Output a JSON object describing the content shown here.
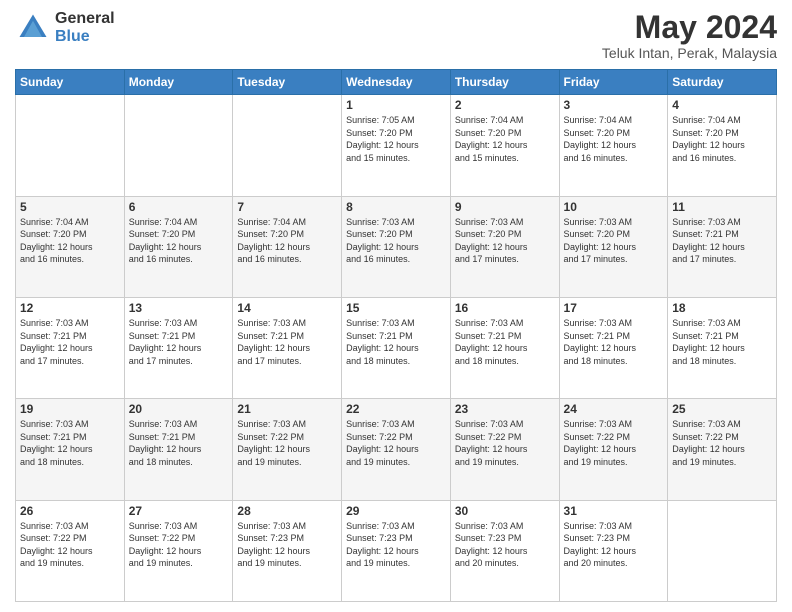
{
  "header": {
    "logo_general": "General",
    "logo_blue": "Blue",
    "month_year": "May 2024",
    "location": "Teluk Intan, Perak, Malaysia"
  },
  "days_of_week": [
    "Sunday",
    "Monday",
    "Tuesday",
    "Wednesday",
    "Thursday",
    "Friday",
    "Saturday"
  ],
  "weeks": [
    [
      {
        "day": "",
        "text": ""
      },
      {
        "day": "",
        "text": ""
      },
      {
        "day": "",
        "text": ""
      },
      {
        "day": "1",
        "text": "Sunrise: 7:05 AM\nSunset: 7:20 PM\nDaylight: 12 hours\nand 15 minutes."
      },
      {
        "day": "2",
        "text": "Sunrise: 7:04 AM\nSunset: 7:20 PM\nDaylight: 12 hours\nand 15 minutes."
      },
      {
        "day": "3",
        "text": "Sunrise: 7:04 AM\nSunset: 7:20 PM\nDaylight: 12 hours\nand 16 minutes."
      },
      {
        "day": "4",
        "text": "Sunrise: 7:04 AM\nSunset: 7:20 PM\nDaylight: 12 hours\nand 16 minutes."
      }
    ],
    [
      {
        "day": "5",
        "text": "Sunrise: 7:04 AM\nSunset: 7:20 PM\nDaylight: 12 hours\nand 16 minutes."
      },
      {
        "day": "6",
        "text": "Sunrise: 7:04 AM\nSunset: 7:20 PM\nDaylight: 12 hours\nand 16 minutes."
      },
      {
        "day": "7",
        "text": "Sunrise: 7:04 AM\nSunset: 7:20 PM\nDaylight: 12 hours\nand 16 minutes."
      },
      {
        "day": "8",
        "text": "Sunrise: 7:03 AM\nSunset: 7:20 PM\nDaylight: 12 hours\nand 16 minutes."
      },
      {
        "day": "9",
        "text": "Sunrise: 7:03 AM\nSunset: 7:20 PM\nDaylight: 12 hours\nand 17 minutes."
      },
      {
        "day": "10",
        "text": "Sunrise: 7:03 AM\nSunset: 7:20 PM\nDaylight: 12 hours\nand 17 minutes."
      },
      {
        "day": "11",
        "text": "Sunrise: 7:03 AM\nSunset: 7:21 PM\nDaylight: 12 hours\nand 17 minutes."
      }
    ],
    [
      {
        "day": "12",
        "text": "Sunrise: 7:03 AM\nSunset: 7:21 PM\nDaylight: 12 hours\nand 17 minutes."
      },
      {
        "day": "13",
        "text": "Sunrise: 7:03 AM\nSunset: 7:21 PM\nDaylight: 12 hours\nand 17 minutes."
      },
      {
        "day": "14",
        "text": "Sunrise: 7:03 AM\nSunset: 7:21 PM\nDaylight: 12 hours\nand 17 minutes."
      },
      {
        "day": "15",
        "text": "Sunrise: 7:03 AM\nSunset: 7:21 PM\nDaylight: 12 hours\nand 18 minutes."
      },
      {
        "day": "16",
        "text": "Sunrise: 7:03 AM\nSunset: 7:21 PM\nDaylight: 12 hours\nand 18 minutes."
      },
      {
        "day": "17",
        "text": "Sunrise: 7:03 AM\nSunset: 7:21 PM\nDaylight: 12 hours\nand 18 minutes."
      },
      {
        "day": "18",
        "text": "Sunrise: 7:03 AM\nSunset: 7:21 PM\nDaylight: 12 hours\nand 18 minutes."
      }
    ],
    [
      {
        "day": "19",
        "text": "Sunrise: 7:03 AM\nSunset: 7:21 PM\nDaylight: 12 hours\nand 18 minutes."
      },
      {
        "day": "20",
        "text": "Sunrise: 7:03 AM\nSunset: 7:21 PM\nDaylight: 12 hours\nand 18 minutes."
      },
      {
        "day": "21",
        "text": "Sunrise: 7:03 AM\nSunset: 7:22 PM\nDaylight: 12 hours\nand 19 minutes."
      },
      {
        "day": "22",
        "text": "Sunrise: 7:03 AM\nSunset: 7:22 PM\nDaylight: 12 hours\nand 19 minutes."
      },
      {
        "day": "23",
        "text": "Sunrise: 7:03 AM\nSunset: 7:22 PM\nDaylight: 12 hours\nand 19 minutes."
      },
      {
        "day": "24",
        "text": "Sunrise: 7:03 AM\nSunset: 7:22 PM\nDaylight: 12 hours\nand 19 minutes."
      },
      {
        "day": "25",
        "text": "Sunrise: 7:03 AM\nSunset: 7:22 PM\nDaylight: 12 hours\nand 19 minutes."
      }
    ],
    [
      {
        "day": "26",
        "text": "Sunrise: 7:03 AM\nSunset: 7:22 PM\nDaylight: 12 hours\nand 19 minutes."
      },
      {
        "day": "27",
        "text": "Sunrise: 7:03 AM\nSunset: 7:22 PM\nDaylight: 12 hours\nand 19 minutes."
      },
      {
        "day": "28",
        "text": "Sunrise: 7:03 AM\nSunset: 7:23 PM\nDaylight: 12 hours\nand 19 minutes."
      },
      {
        "day": "29",
        "text": "Sunrise: 7:03 AM\nSunset: 7:23 PM\nDaylight: 12 hours\nand 19 minutes."
      },
      {
        "day": "30",
        "text": "Sunrise: 7:03 AM\nSunset: 7:23 PM\nDaylight: 12 hours\nand 20 minutes."
      },
      {
        "day": "31",
        "text": "Sunrise: 7:03 AM\nSunset: 7:23 PM\nDaylight: 12 hours\nand 20 minutes."
      },
      {
        "day": "",
        "text": ""
      }
    ]
  ]
}
